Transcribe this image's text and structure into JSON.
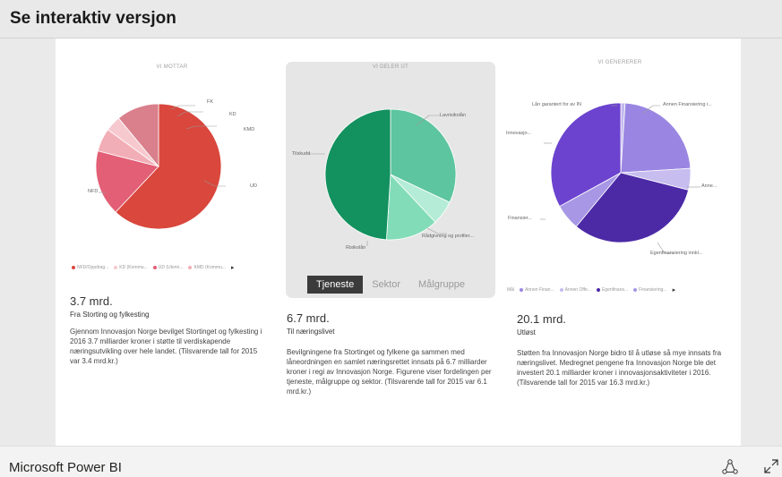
{
  "header": {
    "title": "Se interaktiv versjon"
  },
  "charts": {
    "left": {
      "title": "VI MOTTAR",
      "labels": {
        "nfd": "NFD",
        "fk": "FK",
        "kd": "KD",
        "kmd": "KMD",
        "ud": "UD"
      },
      "legend": [
        "NFD/Oppdrag...",
        "KD (Kommu...",
        "UD (Utenri...",
        "KMD (Kommu..."
      ],
      "colors": {
        "nfd": "#d9473d",
        "ud": "#e35f76",
        "kmd": "#f2aeb6",
        "kd": "#f6c9ce",
        "fk": "#d9808c"
      }
    },
    "middle": {
      "title": "VI DELER UT",
      "labels": {
        "tilskudd": "Tilskudd",
        "lavrisikolan": "Lavrisikolån",
        "radgivning": "Rådgivning og profiler...",
        "risikolan": "Risikolån"
      },
      "tabs": [
        "Tjeneste",
        "Sektor",
        "Målgruppe"
      ],
      "colors": {
        "tilskudd": "#13915f",
        "lavrisikolan": "#5dc59f",
        "radgivning": "#b5ecd8",
        "risikolan": "#83dcb8"
      }
    },
    "right": {
      "title": "VI GENERERER",
      "labels": {
        "lan": "Lån garantert for av IN",
        "annen": "Annen Finansiering i...",
        "anne": "Anne...",
        "innovasjo": "Innovasjo...",
        "finansier": "Finansier...",
        "egen": "Egenfinansiering innkl..."
      },
      "legend": [
        "Mål",
        "Annen Finan...",
        "Annen Offe...",
        "Egenfinans...",
        "Finansiering..."
      ],
      "colors": {
        "innovasjo": "#6c43cf",
        "egen": "#4c2aa6",
        "annen": "#9a86e2",
        "anne": "#c7bdef",
        "finansier": "#a797e4",
        "lan": "#c3b8ee"
      }
    }
  },
  "chart_data": [
    {
      "type": "pie",
      "title": "VI MOTTAR",
      "categories": [
        "NFD",
        "UD",
        "KMD",
        "KD",
        "FK"
      ],
      "values": [
        62,
        17,
        6,
        4,
        11
      ]
    },
    {
      "type": "pie",
      "title": "VI DELER UT",
      "categories": [
        "Lavrisikolån",
        "Rådgivning og profiler...",
        "Risikolån",
        "Tilskudd"
      ],
      "values": [
        32,
        6,
        13,
        49
      ]
    },
    {
      "type": "pie",
      "title": "VI GENERERER",
      "categories": [
        "Lån garantert for av IN",
        "Annen Finansiering i...",
        "Anne...",
        "Egenfinansiering innkl...",
        "Finansier...",
        "Innovasjo..."
      ],
      "values": [
        1,
        23,
        5,
        32,
        6,
        33
      ]
    }
  ],
  "summaries": {
    "left": {
      "amount": "3.7 mrd.",
      "subtitle": "Fra Storting og fylkesting",
      "text": "Gjennom Innovasjon Norge bevilget Stortinget og fylkesting i 2016 3.7 milliarder kroner i støtte til verdiskapende næringsutvikling over hele landet. (Tilsvarende tall for 2015 var 3.4 mrd.kr.)"
    },
    "middle": {
      "amount": "6.7 mrd.",
      "subtitle": "Til næringslivet",
      "text": "Bevilgningene fra Stortinget og fylkene ga sammen med låneordningen en samlet næringsrettet innsats på 6.7 milliarder kroner i regi av Innovasjon Norge. Figurene viser fordelingen per tjeneste, målgruppe og sektor. (Tilsvarende tall for 2015 var 6.1 mrd.kr.)"
    },
    "right": {
      "amount": "20.1 mrd.",
      "subtitle": "Utløst",
      "text": "Støtten fra Innovasjon Norge bidro til å utløse så mye innsats fra næringslivet. Medregnet pengene fra Innovasjon Norge ble det investert 20.1 milliarder kroner i innovasjonsaktiviteter i 2016. (Tilsvarende tall for 2015 var 16.3 mrd.kr.)"
    }
  },
  "footer": {
    "brand": "Microsoft Power BI"
  },
  "icons": {
    "share": "share-icon",
    "expand": "expand-icon"
  }
}
